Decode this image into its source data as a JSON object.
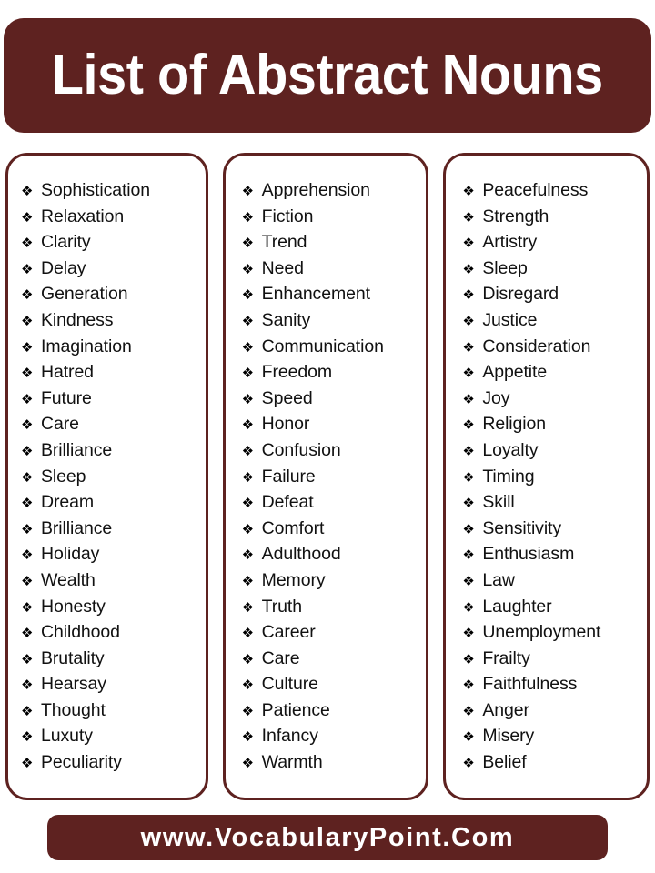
{
  "header": {
    "title": "List of Abstract Nouns",
    "background_color": "#5E2220",
    "text_color": "#FFFFFF"
  },
  "footer": {
    "url": "www.VocabularyPoint.Com",
    "background_color": "#5E2220",
    "text_color": "#FFFFFF"
  },
  "bullet": {
    "glyph": "❖",
    "icon_name": "diamond-bullet-icon"
  },
  "card_border_color": "#5E2220",
  "columns": [
    {
      "id": "column-1",
      "items": [
        "Sophistication",
        "Relaxation",
        "Clarity",
        "Delay",
        "Generation",
        "Kindness",
        "Imagination",
        "Hatred",
        "Future",
        "Care",
        "Brilliance",
        "Sleep",
        "Dream",
        "Brilliance",
        "Holiday",
        "Wealth",
        "Honesty",
        "Childhood",
        "Brutality",
        "Hearsay",
        "Thought",
        "Luxuty",
        "Peculiarity"
      ]
    },
    {
      "id": "column-2",
      "items": [
        "Apprehension",
        "Fiction",
        "Trend",
        "Need",
        "Enhancement",
        "Sanity",
        "Communication",
        "Freedom",
        "Speed",
        "Honor",
        "Confusion",
        "Failure",
        "Defeat",
        "Comfort",
        "Adulthood",
        "Memory",
        "Truth",
        "Career",
        "Care",
        "Culture",
        "Patience",
        "Infancy",
        "Warmth"
      ]
    },
    {
      "id": "column-3",
      "items": [
        "Peacefulness",
        "Strength",
        "Artistry",
        "Sleep",
        "Disregard",
        "Justice",
        "Consideration",
        "Appetite",
        "Joy",
        "Religion",
        "Loyalty",
        "Timing",
        "Skill",
        "Sensitivity",
        "Enthusiasm",
        "Law",
        "Laughter",
        "Unemployment",
        "Frailty",
        "Faithfulness",
        "Anger",
        "Misery",
        "Belief"
      ]
    }
  ]
}
